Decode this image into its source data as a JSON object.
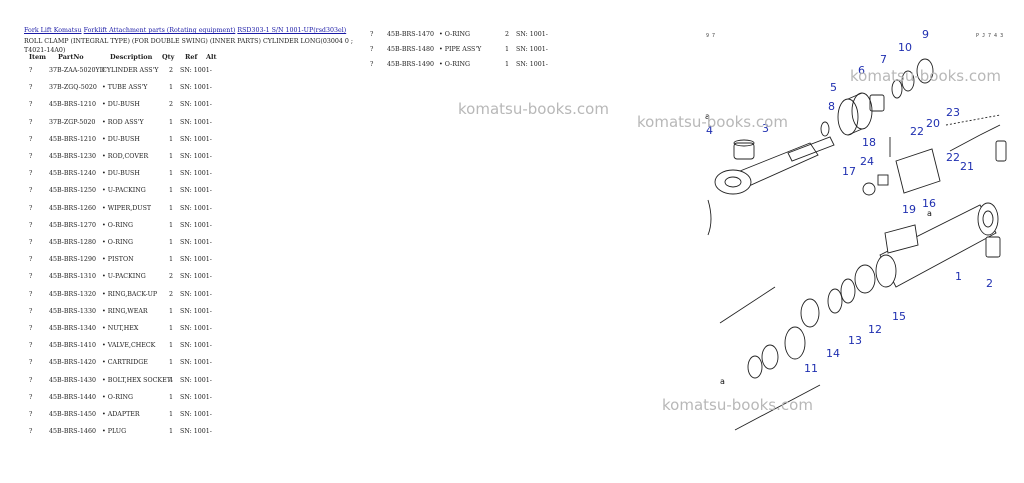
{
  "breadcrumb": {
    "links": [
      "Fork Lift Komatsu",
      "Forklift Attachment parts (Rotating equipment)",
      "RSD303-1 S/N 1001-UP(rsd303el)"
    ]
  },
  "page_title": "ROLL CLAMP (INTEGRAL TYPE) (FOR DOUBLE SWING) (INNER PARTS) CYLINDER LONG(03004 0 ; T4021-14A0)",
  "table_headers": {
    "item": "Item",
    "part": "PartNo",
    "desc": "Description",
    "qty": "Qty",
    "ref": "Ref",
    "alt": "Alt"
  },
  "parts_left": [
    {
      "item": "?",
      "part": "37B-ZAA-5020YD",
      "desc": "CYLINDER ASS'Y",
      "qty": "2",
      "ref": "SN: 1001-"
    },
    {
      "item": "?",
      "part": "37B-ZGQ-5020",
      "desc": "• TUBE ASS'Y",
      "qty": "1",
      "ref": "SN: 1001-"
    },
    {
      "item": "?",
      "part": "45B-BRS-1210",
      "desc": "• DU-BUSH",
      "qty": "2",
      "ref": "SN: 1001-"
    },
    {
      "item": "?",
      "part": "37B-ZGP-5020",
      "desc": "• ROD ASS'Y",
      "qty": "1",
      "ref": "SN: 1001-"
    },
    {
      "item": "?",
      "part": "45B-BRS-1210",
      "desc": "• DU-BUSH",
      "qty": "1",
      "ref": "SN: 1001-"
    },
    {
      "item": "?",
      "part": "45B-BRS-1230",
      "desc": "• ROD,COVER",
      "qty": "1",
      "ref": "SN: 1001-"
    },
    {
      "item": "?",
      "part": "45B-BRS-1240",
      "desc": "• DU-BUSH",
      "qty": "1",
      "ref": "SN: 1001-"
    },
    {
      "item": "?",
      "part": "45B-BRS-1250",
      "desc": "• U-PACKING",
      "qty": "1",
      "ref": "SN: 1001-"
    },
    {
      "item": "?",
      "part": "45B-BRS-1260",
      "desc": "• WIPER,DUST",
      "qty": "1",
      "ref": "SN: 1001-"
    },
    {
      "item": "?",
      "part": "45B-BRS-1270",
      "desc": "• O-RING",
      "qty": "1",
      "ref": "SN: 1001-"
    },
    {
      "item": "?",
      "part": "45B-BRS-1280",
      "desc": "• O-RING",
      "qty": "1",
      "ref": "SN: 1001-"
    },
    {
      "item": "?",
      "part": "45B-BRS-1290",
      "desc": "• PISTON",
      "qty": "1",
      "ref": "SN: 1001-"
    },
    {
      "item": "?",
      "part": "45B-BRS-1310",
      "desc": "• U-PACKING",
      "qty": "2",
      "ref": "SN: 1001-"
    },
    {
      "item": "?",
      "part": "45B-BRS-1320",
      "desc": "• RING,BACK-UP",
      "qty": "2",
      "ref": "SN: 1001-"
    },
    {
      "item": "?",
      "part": "45B-BRS-1330",
      "desc": "• RING,WEAR",
      "qty": "1",
      "ref": "SN: 1001-"
    },
    {
      "item": "?",
      "part": "45B-BRS-1340",
      "desc": "• NUT,HEX",
      "qty": "1",
      "ref": "SN: 1001-"
    },
    {
      "item": "?",
      "part": "45B-BRS-1410",
      "desc": "• VALVE,CHECK",
      "qty": "1",
      "ref": "SN: 1001-"
    },
    {
      "item": "?",
      "part": "45B-BRS-1420",
      "desc": "• CARTRIDGE",
      "qty": "1",
      "ref": "SN: 1001-"
    },
    {
      "item": "?",
      "part": "45B-BRS-1430",
      "desc": "• BOLT,HEX SOCKET",
      "qty": "4",
      "ref": "SN: 1001-"
    },
    {
      "item": "?",
      "part": "45B-BRS-1440",
      "desc": "• O-RING",
      "qty": "1",
      "ref": "SN: 1001-"
    },
    {
      "item": "?",
      "part": "45B-BRS-1450",
      "desc": "• ADAPTER",
      "qty": "1",
      "ref": "SN: 1001-"
    },
    {
      "item": "?",
      "part": "45B-BRS-1460",
      "desc": "• PLUG",
      "qty": "1",
      "ref": "SN: 1001-"
    }
  ],
  "parts_right": [
    {
      "item": "?",
      "part": "45B-BRS-1470",
      "desc": "• O-RING",
      "qty": "2",
      "ref": "SN: 1001-"
    },
    {
      "item": "?",
      "part": "45B-BRS-1480",
      "desc": "• PIPE ASS'Y",
      "qty": "1",
      "ref": "SN: 1001-"
    },
    {
      "item": "?",
      "part": "45B-BRS-1490",
      "desc": "• O-RING",
      "qty": "1",
      "ref": "SN: 1001-"
    }
  ],
  "watermark": "komatsu-books.com",
  "diagram": {
    "corner_left": "9 7",
    "corner_right": "P J 7 4 3",
    "callouts": [
      "1",
      "2",
      "3",
      "4",
      "5",
      "6",
      "7",
      "8",
      "9",
      "10",
      "11",
      "12",
      "13",
      "14",
      "15",
      "16",
      "17",
      "18",
      "19",
      "20",
      "21",
      "22",
      "23",
      "24",
      "a"
    ],
    "accent_color": "#1f2fb0"
  }
}
